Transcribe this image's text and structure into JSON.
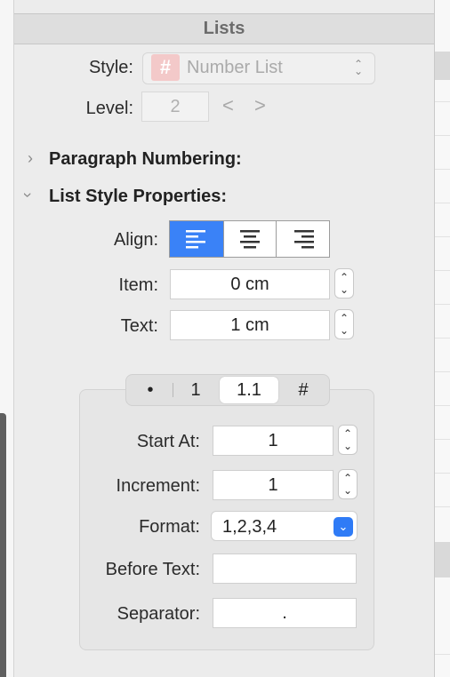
{
  "panel": {
    "title": "Lists"
  },
  "style": {
    "label": "Style:",
    "value": "Number List",
    "icon": "hash-icon"
  },
  "level": {
    "label": "Level:",
    "value": "2",
    "prev": "<",
    "next": ">"
  },
  "paragraph_numbering": {
    "title": "Paragraph Numbering:",
    "expanded": false
  },
  "list_style_properties": {
    "title": "List Style Properties:",
    "expanded": true,
    "align": {
      "label": "Align:",
      "options": [
        "align-left",
        "align-center",
        "align-right"
      ],
      "selected": "align-left"
    },
    "item": {
      "label": "Item:",
      "value": "0 cm"
    },
    "text": {
      "label": "Text:",
      "value": "1 cm"
    }
  },
  "tabs": {
    "items": [
      "•",
      "1",
      "1.1",
      "#"
    ],
    "selected": "1.1"
  },
  "numbering": {
    "start_at": {
      "label": "Start At:",
      "value": "1"
    },
    "increment": {
      "label": "Increment:",
      "value": "1"
    },
    "format": {
      "label": "Format:",
      "value": "1,2,3,4"
    },
    "before_text": {
      "label": "Before Text:",
      "value": ""
    },
    "separator": {
      "label": "Separator:",
      "value": "."
    }
  },
  "colors": {
    "accent": "#3a82f7",
    "header_text": "#6c6c6c",
    "panel_bg": "#ececec"
  }
}
